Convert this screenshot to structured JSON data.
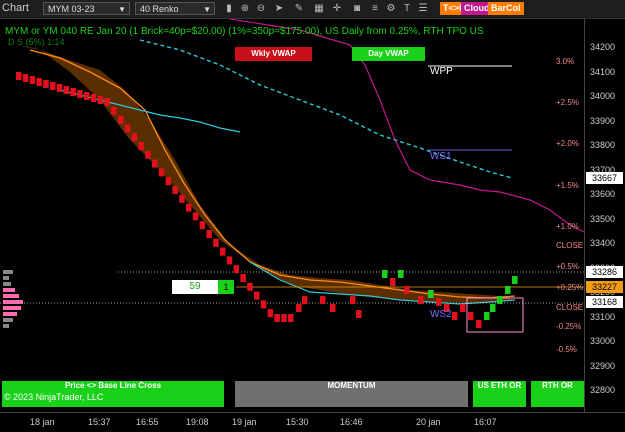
{
  "toolbar": {
    "title": "Chart",
    "instrument": "MYM 03-23",
    "bar_type": "40 Renko",
    "badges": [
      {
        "label": "T<>K",
        "color": "#ff7a00"
      },
      {
        "label": "Cloud",
        "color": "#c2188c"
      },
      {
        "label": "BarCol",
        "color": "#ff7a00"
      }
    ]
  },
  "chart": {
    "info_line": "MYM or YM 040 RE Jan 20 (1 Brick=40p=$20.00) (1%=350p=$175.00), US Daily from 0.25%, RTH TPO US",
    "info_line2": "D S (5%) 1:14",
    "wkly_vwap_label": "Wkly VWAP",
    "day_vwap_label": "Day VWAP",
    "wpp_label": "WPP",
    "ws1_label": "WS1",
    "ws2_label": "WS2",
    "close_label": "CLOSE",
    "close_label2": "CLOSE",
    "ticker_box": {
      "value": "59",
      "side": "1"
    },
    "pct_labels": [
      "3.0%",
      "+2.5%",
      "+2.0%",
      "+1.5%",
      "+1.0%",
      "+0.5%",
      "+0.25%",
      "-0.25%",
      "-0.5%"
    ],
    "price_ticks": [
      "34200",
      "34100",
      "34000",
      "33900",
      "33800",
      "33700",
      "33600",
      "33500",
      "33400",
      "33300",
      "33200",
      "33100",
      "33000",
      "32900",
      "32800"
    ],
    "price_boxes": [
      {
        "value": "33667",
        "bg": "#ffffff",
        "fg": "#000000"
      },
      {
        "value": "33286",
        "bg": "#ffffff",
        "fg": "#000000"
      },
      {
        "value": "33227",
        "bg": "#f39c12",
        "fg": "#000000"
      },
      {
        "value": "33168",
        "bg": "#ffffff",
        "fg": "#000000"
      }
    ],
    "x_ticks": [
      "18 jan",
      "15:37",
      "16:55",
      "19:08",
      "19 jan",
      "15:30",
      "16:46",
      "20 jan",
      "16:07"
    ]
  },
  "bottom": {
    "cross_label": "Price <> Base Line Cross",
    "momentum_label": "MOMENTUM",
    "us_eth_or_label": "US ETH OR",
    "rth_or_label": "RTH OR",
    "copyright": "© 2023 NinjaTrader, LLC"
  },
  "colors": {
    "up_brick": "#19d119",
    "down_brick": "#e0101c",
    "cloud": "#7a3d00",
    "orange_line": "#ff8c1a",
    "cyan_line": "#30c8d8",
    "magenta_line": "#c2188c"
  }
}
